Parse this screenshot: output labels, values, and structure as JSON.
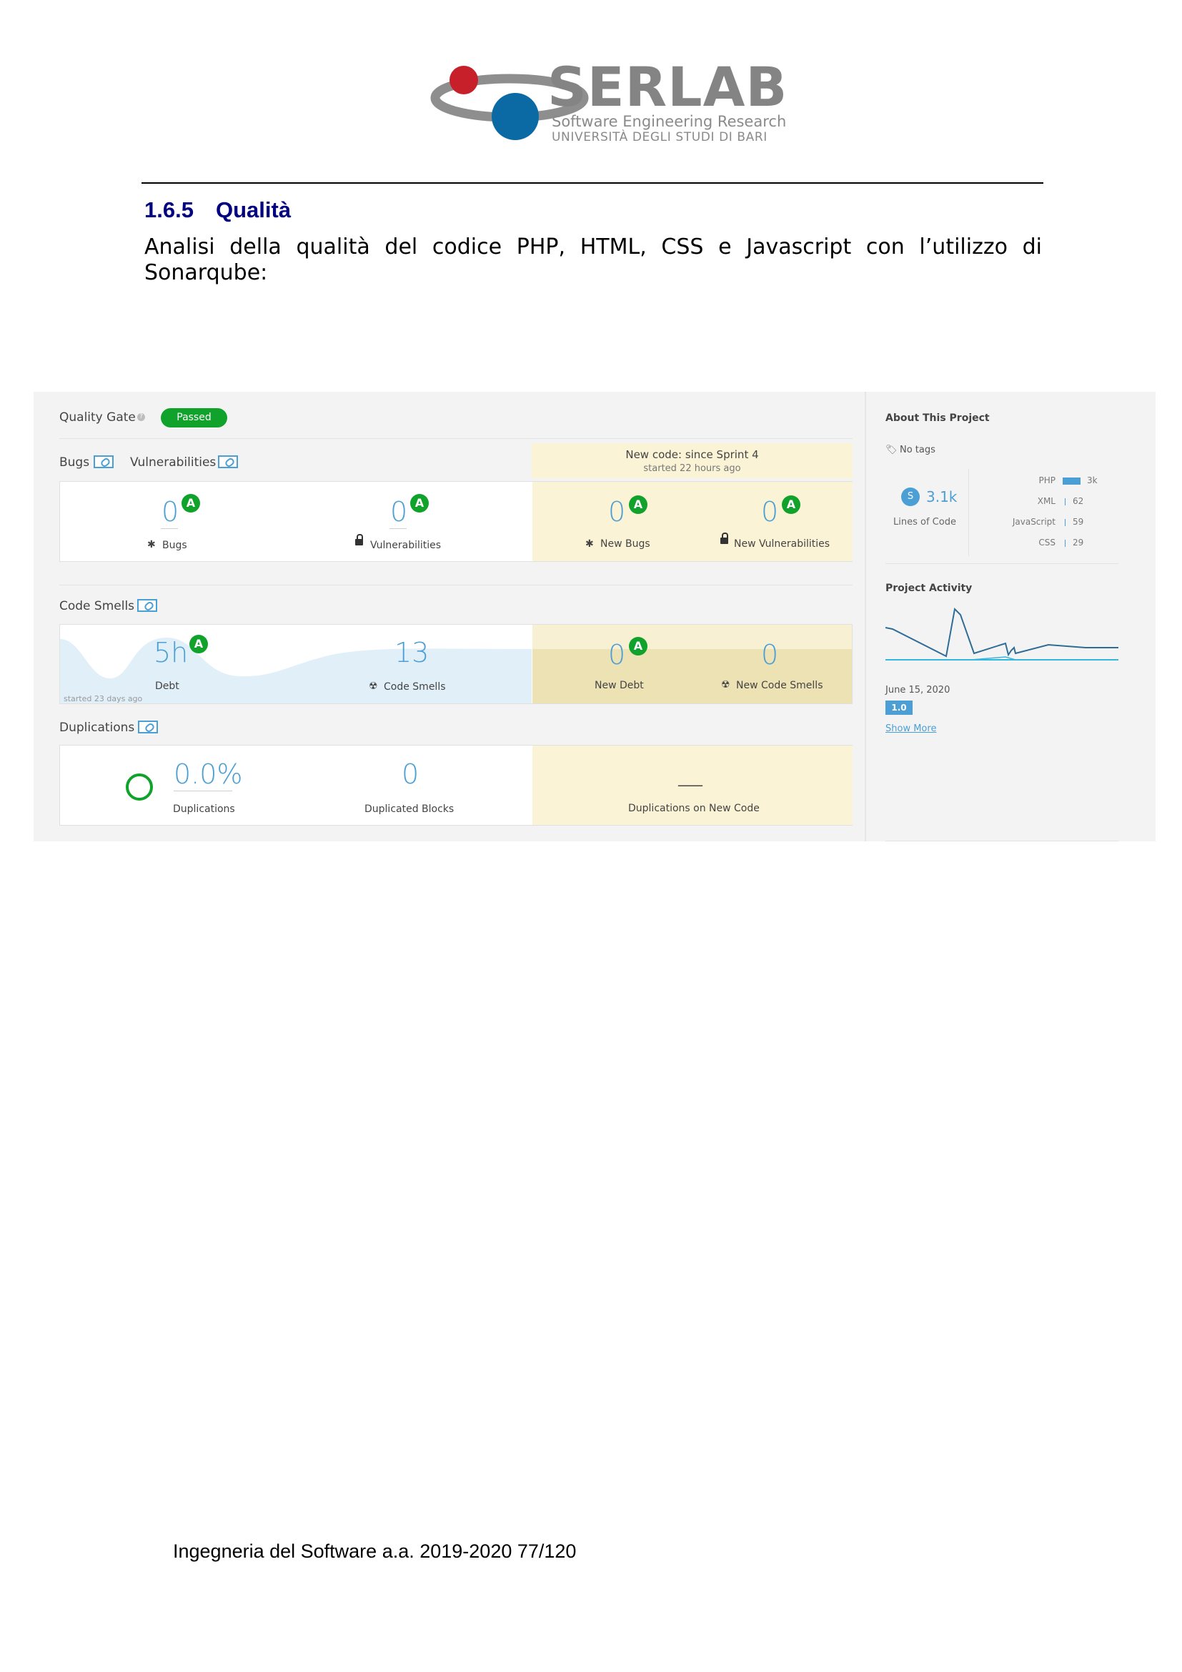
{
  "header": {
    "logo_word": "SERLAB",
    "logo_sub1": "Software Engineering Research",
    "logo_sub2": "UNIVERSITÀ DEGLI STUDI DI BARI"
  },
  "section": {
    "number": "1.6.5",
    "title": "Qualità",
    "intro": "Analisi della qualità del codice PHP, HTML, CSS e Javascript con l’utilizzo di Sonarqube:"
  },
  "sonar": {
    "quality_gate_label": "Quality Gate",
    "quality_gate_status": "Passed",
    "bugs_label": "Bugs",
    "vulnerabilities_label": "Vulnerabilities",
    "new_code_title": "New code: since Sprint 4",
    "new_code_started": "started 22 hours ago",
    "bugs_value": "0",
    "bugs_caption": "Bugs",
    "vuln_value": "0",
    "vuln_caption": "Vulnerabilities",
    "new_bugs_value": "0",
    "new_bugs_caption": "New Bugs",
    "new_vuln_value": "0",
    "new_vuln_caption": "New Vulnerabilities",
    "grade": "A",
    "code_smells_label": "Code Smells",
    "debt_value": "5h",
    "debt_caption": "Debt",
    "smells_value": "13",
    "smells_caption": "Code Smells",
    "started_ago": "started 23 days ago",
    "new_debt_value": "0",
    "new_debt_caption": "New Debt",
    "new_smells_value": "0",
    "new_smells_caption": "New Code Smells",
    "duplications_label": "Duplications",
    "dup_value": "0.0%",
    "dup_caption": "Duplications",
    "dup_blocks_value": "0",
    "dup_blocks_caption": "Duplicated Blocks",
    "dup_new_value": "—",
    "dup_new_caption": "Duplications on New Code"
  },
  "sidebar": {
    "about_title": "About This Project",
    "tags": "No tags",
    "loc_badge": "S",
    "loc_value": "3.1k",
    "loc_caption": "Lines of Code",
    "languages": [
      {
        "name": "PHP",
        "value": "3k"
      },
      {
        "name": "XML",
        "value": "62"
      },
      {
        "name": "JavaScript",
        "value": "59"
      },
      {
        "name": "CSS",
        "value": "29"
      }
    ],
    "activity_title": "Project Activity",
    "activity_date": "June 15, 2020",
    "version": "1.0",
    "show_more": "Show More"
  },
  "footer": {
    "text": "Ingegneria del Software a.a. 2019-2020 77/120"
  },
  "colors": {
    "heading": "#000080",
    "grade_green": "#11a22c",
    "sonar_blue": "#4b9fd5",
    "new_code_bg": "#fbf3d5"
  }
}
